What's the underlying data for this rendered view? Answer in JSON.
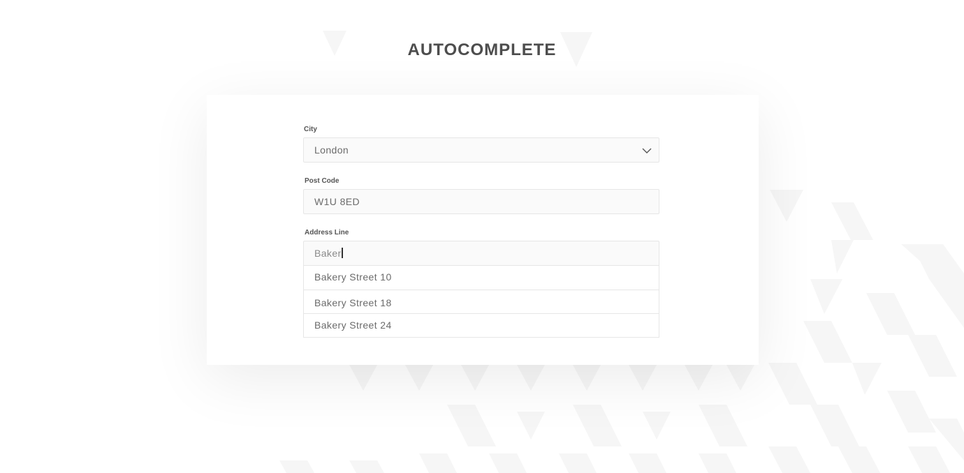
{
  "page": {
    "title": "AUTOCOMPLETE"
  },
  "form": {
    "city": {
      "label": "City",
      "value": "London",
      "icon": "chevron-down-icon"
    },
    "post_code": {
      "label": "Post Code",
      "value": "W1U 8ED"
    },
    "address_line": {
      "label": "Address Line",
      "value": "Baker",
      "suggestions": [
        {
          "label": "Bakery Street 10"
        },
        {
          "label": "Bakery Street 18"
        },
        {
          "label": "Bakery Street 24"
        }
      ]
    }
  },
  "colors": {
    "background": "#ffffff",
    "title": "#4d4d4d",
    "input_background": "#fafafa",
    "border": "#e6e6e6",
    "text": "#6b6b6b",
    "pattern": "#f5f5f5"
  }
}
